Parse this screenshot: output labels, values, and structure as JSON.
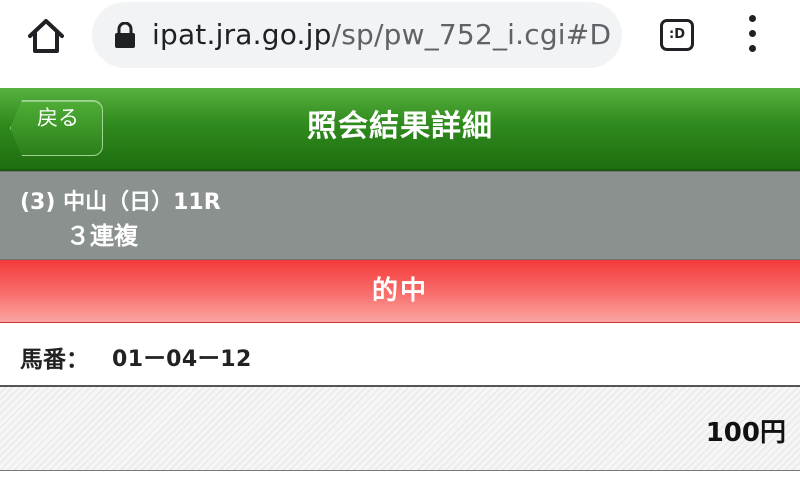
{
  "browser": {
    "url_host": "ipat.jra.go.jp",
    "url_path": "/sp/pw_752_i.cgi#D",
    "tab_switcher_label": ":D",
    "icons": [
      "home-icon",
      "lock-icon",
      "tab-switcher-icon",
      "more-vert-icon"
    ]
  },
  "header": {
    "back_label": "戻る",
    "title": "照会結果詳細",
    "color": "#2f8a1d"
  },
  "race": {
    "line1": "(3) 中山（日）11R",
    "bet_type": "３連複"
  },
  "result": {
    "label": "的中",
    "color": "#f43a3a"
  },
  "detail": {
    "horse_label": "馬番：",
    "horse_numbers": "01ー04ー12",
    "amount": "100円"
  }
}
